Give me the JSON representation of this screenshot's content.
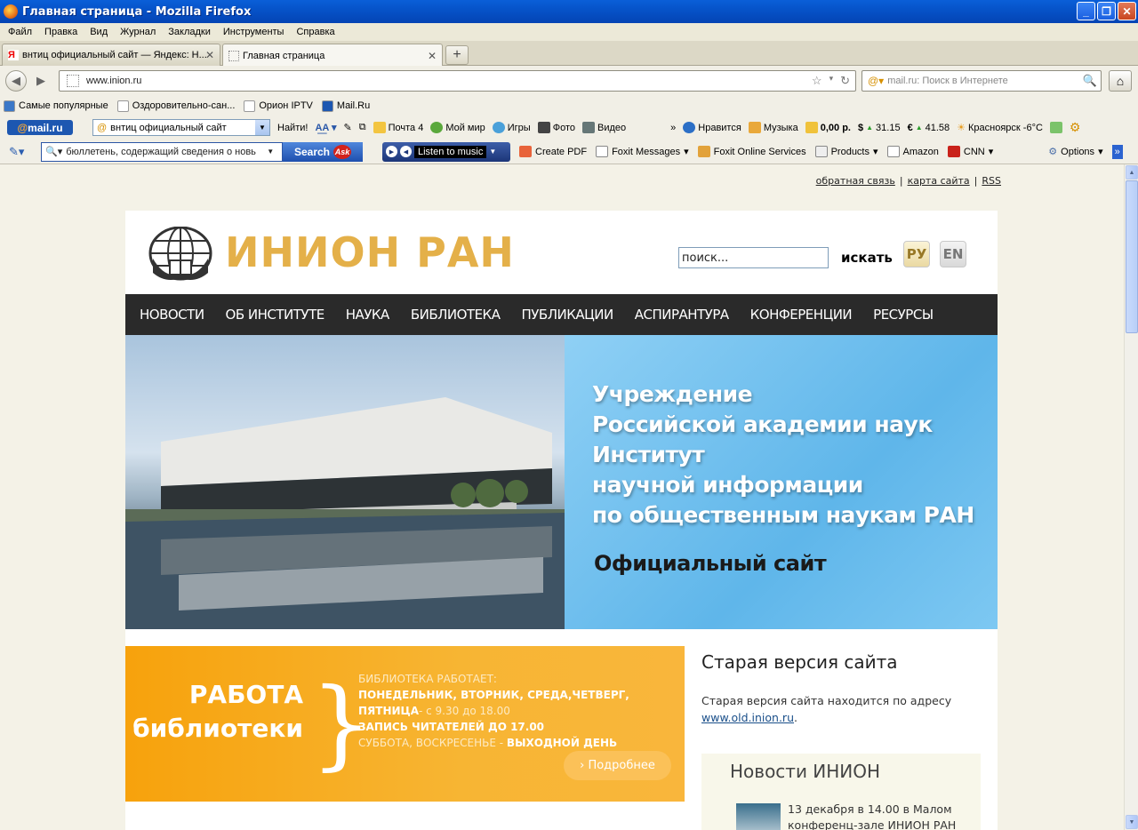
{
  "window": {
    "title": "Главная страница - Mozilla Firefox"
  },
  "menu": [
    "Файл",
    "Правка",
    "Вид",
    "Журнал",
    "Закладки",
    "Инструменты",
    "Справка"
  ],
  "tabs": [
    {
      "label": "внтиц официальный сайт — Яндекс: Н...",
      "active": false
    },
    {
      "label": "Главная страница",
      "active": true
    }
  ],
  "nav": {
    "url": "www.inion.ru",
    "search_placeholder": "mail.ru: Поиск в Интернете"
  },
  "bookmarks": [
    "Самые популярные",
    "Оздоровительно-сан...",
    "Орион IPTV",
    "Mail.Ru"
  ],
  "mailbar": {
    "search_value": "внтиц официальный сайт",
    "find": "Найти!",
    "mail": "Почта 4",
    "myworld": "Мой мир",
    "games": "Игры",
    "photo": "Фото",
    "video": "Видео",
    "like": "Нравится",
    "music": "Музыка",
    "balance": "0,00 р.",
    "usd": "31.15",
    "eur": "41.58",
    "weather": "Красноярск -6°C"
  },
  "askbar": {
    "search_value": "бюллетень, содержащий сведения о новь",
    "search_btn": "Search",
    "listen": "Listen to music",
    "items": [
      "Create PDF",
      "Foxit Messages",
      "Foxit Online Services",
      "Products",
      "Amazon",
      "CNN"
    ],
    "options": "Options"
  },
  "page": {
    "toplinks": [
      "обратная связь",
      "карта сайта",
      "RSS"
    ],
    "site_name": "ИНИОН РАН",
    "search_value": "поиск...",
    "search_btn": "искать",
    "lang_ru": "РУ",
    "lang_en": "EN",
    "nav": [
      "НОВОСТИ",
      "ОБ ИНСТИТУТЕ",
      "НАУКА",
      "БИБЛИОТЕКА",
      "ПУБЛИКАЦИИ",
      "АСПИРАНТУРА",
      "КОНФЕРЕНЦИИ",
      "РЕСУРСЫ"
    ],
    "banner_lines": [
      "Учреждение",
      "Российской академии наук",
      "Институт",
      "научной информации",
      "по общественным наукам РАН"
    ],
    "banner_official": "Официальный сайт",
    "work": {
      "title1": "РАБОТА",
      "title2": "библиотеки",
      "line1": "БИБЛИОТЕКА РАБОТАЕТ:",
      "line2": "ПОНЕДЕЛЬНИК, ВТОРНИК, СРЕДА,ЧЕТВЕРГ,",
      "line3a": "ПЯТНИЦА",
      "line3b": "- с 9.30 до 18.00",
      "line4": "ЗАПИСЬ ЧИТАТЕЛЕЙ ДО 17.00",
      "line5a": "СУББОТА, ВОСКРЕСЕНЬЕ - ",
      "line5b": "ВЫХОДНОЙ ДЕНЬ",
      "more": "› Подробнее"
    },
    "old": {
      "title": "Старая версия сайта",
      "text": "Старая версия сайта находится по адресу",
      "link": "www.old.inion.ru"
    },
    "news": {
      "title": "Новости ИНИОН",
      "item": "13 декабря в 14.00 в Малом конференц-зале ИНИОН РАН"
    }
  }
}
